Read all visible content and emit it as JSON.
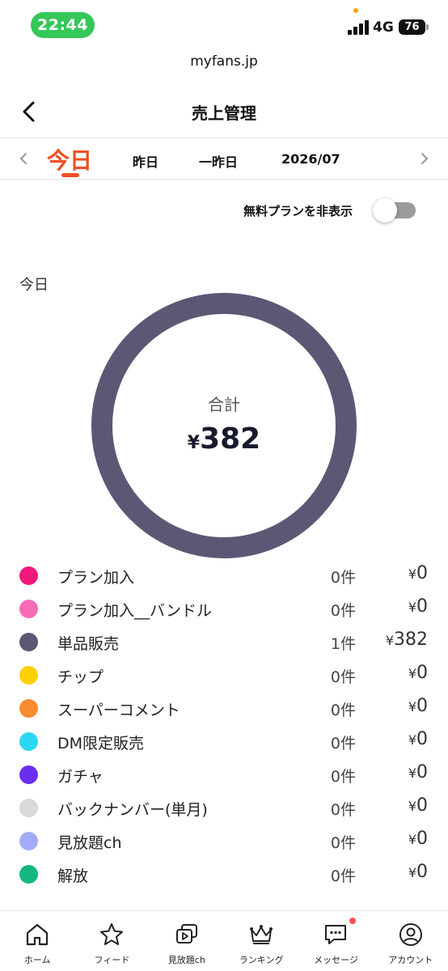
{
  "status_bar": {
    "time": "22:44",
    "network": "4G",
    "battery": "76"
  },
  "browser": {
    "url": "myfans.jp"
  },
  "header": {
    "title": "売上管理"
  },
  "tabs": {
    "today": "今日",
    "yesterday": "昨日",
    "day_before": "一昨日",
    "month": "2026/07"
  },
  "toggle": {
    "label": "無料プランを非表示",
    "on": false
  },
  "summary": {
    "period": "今日",
    "total_label": "合計",
    "total_currency": "¥",
    "total_value": "382",
    "ring_color": "#5b5775"
  },
  "legend": [
    {
      "name": "プラン加入",
      "count": "0件",
      "currency": "¥",
      "amount": "0",
      "color": "#f0197a"
    },
    {
      "name": "プラン加入__バンドル",
      "count": "0件",
      "currency": "¥",
      "amount": "0",
      "color": "#f56cb4"
    },
    {
      "name": "単品販売",
      "count": "1件",
      "currency": "¥",
      "amount": "382",
      "color": "#5b5775"
    },
    {
      "name": "チップ",
      "count": "0件",
      "currency": "¥",
      "amount": "0",
      "color": "#ffd000"
    },
    {
      "name": "スーパーコメント",
      "count": "0件",
      "currency": "¥",
      "amount": "0",
      "color": "#f78c2e"
    },
    {
      "name": "DM限定販売",
      "count": "0件",
      "currency": "¥",
      "amount": "0",
      "color": "#2dd6f5"
    },
    {
      "name": "ガチャ",
      "count": "0件",
      "currency": "¥",
      "amount": "0",
      "color": "#6a2ef0"
    },
    {
      "name": "バックナンバー(単月)",
      "count": "0件",
      "currency": "¥",
      "amount": "0",
      "color": "#d9d9d9"
    },
    {
      "name": "見放題ch",
      "count": "0件",
      "currency": "¥",
      "amount": "0",
      "color": "#a3aaf7"
    },
    {
      "name": "解放",
      "count": "0件",
      "currency": "¥",
      "amount": "0",
      "color": "#14b87c"
    }
  ],
  "nav": [
    {
      "label": "ホーム",
      "icon": "home-icon"
    },
    {
      "label": "フィード",
      "icon": "star-icon"
    },
    {
      "label": "見放題ch",
      "icon": "video-stack-icon"
    },
    {
      "label": "ランキング",
      "icon": "crown-icon"
    },
    {
      "label": "メッセージ",
      "icon": "chat-icon"
    },
    {
      "label": "アカウント",
      "icon": "user-circle-icon"
    }
  ]
}
